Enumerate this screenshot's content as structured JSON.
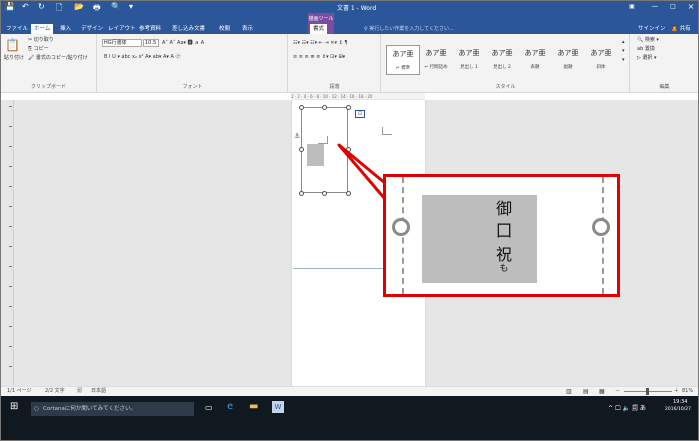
{
  "window": {
    "title": "文書 1 - Word",
    "context_group": "描画ツール",
    "help_icon": "restore-icon",
    "min_label": "－",
    "max_label": "□",
    "close_label": "×"
  },
  "quick_access": {
    "save": "💾",
    "undo": "↶",
    "redo": "↻",
    "new": "🗋",
    "open": "📂",
    "print": "🖶",
    "preview": "🔍",
    "more": "▾"
  },
  "tabs": [
    "ファイル",
    "ホーム",
    "挿入",
    "デザイン",
    "レイアウト",
    "参考資料",
    "差し込み文書",
    "校閲",
    "表示",
    "書式"
  ],
  "tell_me": "♀ 実行したい作業を入力してください...",
  "account": {
    "signin": "サインイン",
    "share": "🙎 共有"
  },
  "ribbon": {
    "clipboard": {
      "label": "クリップボード",
      "paste": "貼り付け",
      "cut": "✂ 切り取り",
      "copy": "⎘ コピー",
      "format_painter": "🖌 書式のコピー/貼り付け"
    },
    "font": {
      "label": "フォント",
      "name": "HG行書体",
      "size": "10.5",
      "row1": "A˄ A˅ Aa▾ 🅰 ａ A",
      "row2": "B I U ▾ abc x₂ x² A▾ ab▾ A▾ A ㋐"
    },
    "paragraph": {
      "label": "段落",
      "row1": "☷▾ ☷▾ ☷▾ ⇤ ⇥ ✕▾ ↕ ¶",
      "row2": "≡ ≡ ≡ ≣ ≡ ⇕▾ ⊡▾ ⊞▾"
    },
    "styles": {
      "label": "スタイル",
      "items": [
        {
          "sample": "あア亜",
          "name": "↵ 標準"
        },
        {
          "sample": "あア亜",
          "name": "↵ 行間詰め"
        },
        {
          "sample": "あア亜",
          "name": "見出し 1"
        },
        {
          "sample": "あア亜",
          "name": "見出し 2"
        },
        {
          "sample": "あア亜",
          "name": "表題"
        },
        {
          "sample": "あア亜",
          "name": "副題"
        },
        {
          "sample": "あア亜",
          "name": "斜体"
        }
      ]
    },
    "editing": {
      "label": "編集",
      "find": "🔍 検索 ▾",
      "replace": "ab 置換",
      "select": "▷ 選択 ▾"
    }
  },
  "ruler": {
    "ticks": "2 · 2 · 4 · 6 · 8 · 10 · 12 · 14 · 16 · 18 · 20"
  },
  "callout": {
    "chars": [
      "御",
      "囗",
      "祝"
    ],
    "small": "も"
  },
  "status": {
    "page": "1/1 ページ",
    "words": "2/2 文字",
    "check": "🗐",
    "lang": "日本語",
    "zoom": "81%",
    "zoom_minus": "－",
    "zoom_plus": "＋"
  },
  "taskbar": {
    "search": "Cortanaに何か聞いてみてください。",
    "time": "19:34",
    "date": "2016/10/27",
    "tray": "^ 🖵 🔈 🗐 あ"
  },
  "colors": {
    "accent": "#2b579a",
    "callout": "#e00000",
    "ctx_tab": "#7a4b9e"
  }
}
